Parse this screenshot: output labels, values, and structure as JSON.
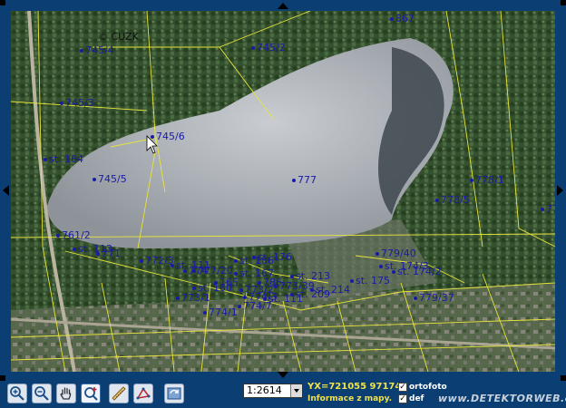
{
  "map": {
    "copyright": "© CUZK",
    "parcels": [
      {
        "label": "867"
      },
      {
        "label": "745/4"
      },
      {
        "label": "745/2"
      },
      {
        "label": "745/3"
      },
      {
        "label": "745/6"
      },
      {
        "label": "st. 164"
      },
      {
        "label": "745/5"
      },
      {
        "label": "777"
      },
      {
        "label": "778/1"
      },
      {
        "label": "778/5"
      },
      {
        "label": "77"
      },
      {
        "label": "761/2"
      },
      {
        "label": "st. 113"
      },
      {
        "label": "771"
      },
      {
        "label": "772/3"
      },
      {
        "label": "st. 111"
      },
      {
        "label": "774"
      },
      {
        "label": "777/20"
      },
      {
        "label": "st. 186"
      },
      {
        "label": "st. 176"
      },
      {
        "label": "st. 167"
      },
      {
        "label": "165"
      },
      {
        "label": "st. 160"
      },
      {
        "label": "773/2"
      },
      {
        "label": "786"
      },
      {
        "label": "773/39"
      },
      {
        "label": "st. 213"
      },
      {
        "label": "st. 214"
      },
      {
        "label": "st. 209"
      },
      {
        "label": "st. 175"
      },
      {
        "label": "779/40"
      },
      {
        "label": "st. 174/3"
      },
      {
        "label": "st. 174/2"
      },
      {
        "label": "773/1"
      },
      {
        "label": "774/1"
      },
      {
        "label": "774/7"
      },
      {
        "label": "774/3"
      },
      {
        "label": "st. 111"
      },
      {
        "label": "779/37"
      }
    ]
  },
  "toolbar": {
    "tools": [
      "zoom-in-icon",
      "zoom-out-icon",
      "pan-hand-icon",
      "zoom-box-icon",
      "measure-icon",
      "area-icon",
      "refresh-icon"
    ],
    "scale_value": "1:2614",
    "coordinates": "YX=721055 971741",
    "info_link": "Informace z mapy.",
    "ortofoto_label": "ortofoto",
    "ortofoto_checked": "✓",
    "second_layer_label": "def",
    "second_layer_checked": "✓",
    "watermark": "www.DETEKTORWEB.cz"
  }
}
